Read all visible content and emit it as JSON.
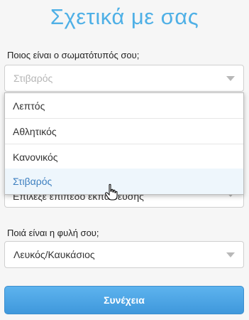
{
  "page": {
    "title": "Σχετικά με σας"
  },
  "body_type": {
    "label": "Ποιος είναι ο σωματότυπός σου;",
    "selected_value": "Στιβαρός",
    "options": [
      "Λεπτός",
      "Αθλητικός",
      "Κανονικός",
      "Στιβαρός"
    ]
  },
  "education": {
    "placeholder": "Επίλεξε επίπεδο εκπαίδευσης"
  },
  "ethnicity": {
    "label": "Ποιά είναι η φυλή σου;",
    "value": "Λευκός/Καυκάσιος"
  },
  "actions": {
    "continue_label": "Συνέχεια"
  },
  "colors": {
    "title": "#4fb0e6",
    "button": "#4fa8e8",
    "selected_option_bg": "#eef6fc"
  }
}
